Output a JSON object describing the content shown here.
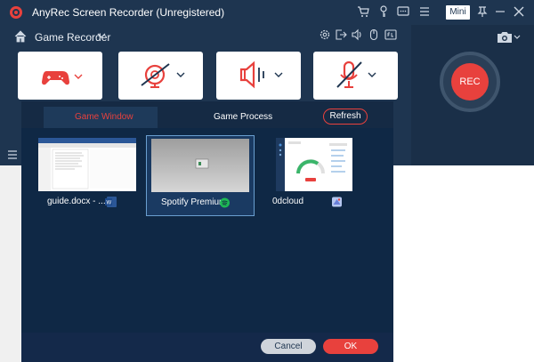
{
  "app": {
    "title": "AnyRec Screen Recorder (Unregistered)",
    "mini_label": "Mini",
    "breadcrumb": "Game Recorder",
    "rec_label": "REC",
    "accent_color": "#e8413d",
    "bg_color": "#1e3550"
  },
  "titlebar_icons": [
    "cart-icon",
    "key-icon",
    "chat-icon",
    "menu-icon",
    "pin-icon",
    "minimize-icon",
    "close-icon"
  ],
  "toolbar_icons": [
    "settings-icon",
    "export-icon",
    "volume-icon",
    "mouse-icon",
    "fps-icon"
  ],
  "panels": [
    {
      "name": "game-source",
      "icon": "gamepad-icon"
    },
    {
      "name": "webcam",
      "icon": "webcam-off-icon"
    },
    {
      "name": "system-sound",
      "icon": "speaker-icon"
    },
    {
      "name": "microphone",
      "icon": "mic-off-icon"
    }
  ],
  "dialog": {
    "tabs": [
      {
        "label": "Game Window",
        "active": true
      },
      {
        "label": "Game Process",
        "active": false
      }
    ],
    "refresh_label": "Refresh",
    "windows": [
      {
        "label": "guide.docx - ...",
        "app_icon": "word-icon",
        "selected": false
      },
      {
        "label": "Spotify Premium",
        "app_icon": "spotify-icon",
        "selected": true
      },
      {
        "label": "0dcloud",
        "app_icon": "app-icon",
        "selected": false
      }
    ],
    "cancel_label": "Cancel",
    "ok_label": "OK"
  }
}
